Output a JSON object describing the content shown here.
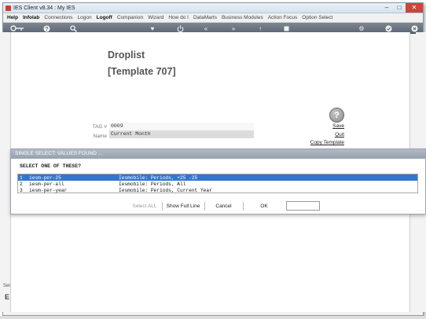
{
  "window": {
    "title": "IES Client v8.34 : My IES"
  },
  "menu": [
    {
      "label": "Help",
      "bold": true
    },
    {
      "label": "Infolab",
      "bold": true
    },
    {
      "label": "Connections",
      "bold": false
    },
    {
      "label": "Logon",
      "bold": false
    },
    {
      "label": "Logoff",
      "bold": true
    },
    {
      "label": "Companion",
      "bold": false
    },
    {
      "label": "Wizard",
      "bold": false
    },
    {
      "label": "How do I",
      "bold": false
    },
    {
      "label": "DataMarts",
      "bold": false
    },
    {
      "label": "Business Modules",
      "bold": false
    },
    {
      "label": "Action Focus",
      "bold": false
    },
    {
      "label": "Option Select",
      "bold": false
    }
  ],
  "toolbar_icons": [
    "key-icon",
    "help-icon",
    "search-icon",
    "heart-icon",
    "power-icon",
    "rewind-icon",
    "fast-forward-icon",
    "upload-icon",
    "stop-icon",
    "settings-icon",
    "check-icon",
    "close-icon"
  ],
  "page": {
    "heading": "Droplist",
    "subheading": "[Template 707]"
  },
  "form": {
    "tag_label": "TAG #",
    "tag_value": "0009",
    "name_label": "Name",
    "name_value": "Current Month"
  },
  "actions": {
    "help_icon_glyph": "?",
    "save": "Save",
    "quit": "Quit",
    "copy_template": "Copy Template"
  },
  "dialog": {
    "title": "SINGLE SELECT: VALUES FOUND ...",
    "prompt": "SELECT ONE OF THESE?",
    "rows": [
      {
        "num": "1",
        "code": "iesm-per-25",
        "desc": "Iesmobile: Periods, +25 -25",
        "selected": true
      },
      {
        "num": "2",
        "code": "iesm-per-all",
        "desc": "Iesmobile: Periods, All",
        "selected": false
      },
      {
        "num": "3",
        "code": "iesm-per-year",
        "desc": "Iesmobile: Periods, Current Year",
        "selected": false
      }
    ],
    "buttons": {
      "select_all": "Select ALL",
      "show_full_line": "Show Full Line",
      "cancel": "Cancel",
      "ok": "OK"
    },
    "input_value": ""
  },
  "bottom": {
    "tab_label": "Sel",
    "mark": "E"
  },
  "colors": {
    "selection": "#3076d3",
    "toolbar": "#6b7480",
    "dialog_title": "#a4aeba"
  }
}
